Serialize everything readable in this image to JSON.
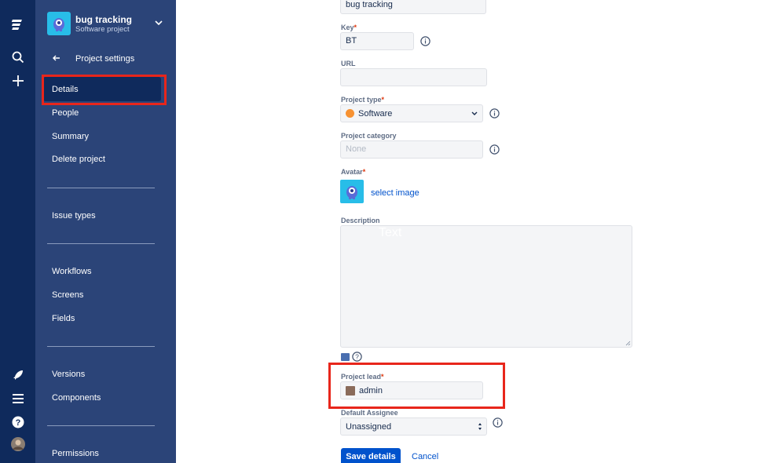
{
  "project": {
    "name": "bug tracking",
    "type": "Software project"
  },
  "sidebar": {
    "back_label": "Project settings",
    "items": [
      {
        "label": "Details"
      },
      {
        "label": "People"
      },
      {
        "label": "Summary"
      },
      {
        "label": "Delete project"
      },
      {
        "label": "Issue types"
      },
      {
        "label": "Workflows"
      },
      {
        "label": "Screens"
      },
      {
        "label": "Fields"
      },
      {
        "label": "Versions"
      },
      {
        "label": "Components"
      },
      {
        "label": "Permissions"
      }
    ]
  },
  "form": {
    "name_value": "bug tracking",
    "key_label": "Key",
    "key_value": "BT",
    "url_label": "URL",
    "url_value": "",
    "project_type_label": "Project type",
    "project_type_value": "Software",
    "project_category_label": "Project category",
    "project_category_placeholder": "None",
    "avatar_label": "Avatar",
    "select_image": "select image",
    "description_label": "Description",
    "description_overlay": "Text",
    "project_lead_label": "Project lead",
    "project_lead_value": "admin",
    "default_assignee_label": "Default Assignee",
    "default_assignee_value": "Unassigned",
    "save_label": "Save details",
    "cancel_label": "Cancel"
  },
  "colors": {
    "rail": "#0f2a5c",
    "sidebar": "#2b4478",
    "highlight": "#e8261b",
    "primary": "#0052cc"
  }
}
